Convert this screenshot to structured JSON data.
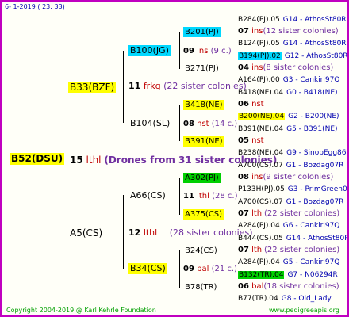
{
  "header": {
    "date": "6-  1-2019 (  23:  33)"
  },
  "footer": {
    "copyright": "Copyright 2004-2019 @ Karl Kehrle Foundation",
    "url": "www.pedigreeapis.org"
  },
  "root": {
    "name": "B52(DSU)",
    "num": "15",
    "code": "lthl",
    "note": "(Drones from 31 sister colonies)"
  },
  "gen1": [
    {
      "name": "B33(BZF)",
      "num": "11",
      "code": "frkg",
      "note": "(22 sister colonies)"
    },
    {
      "name": "A5(CS)",
      "num": "12",
      "code": "lthl",
      "note": "(28 sister colonies)"
    }
  ],
  "gen2": [
    {
      "name": "B100(JG)",
      "num": "09",
      "code": "ins",
      "note": "(9 c.)"
    },
    {
      "name": "B104(SL)",
      "num": "08",
      "code": "nst",
      "note": "(14 c.)"
    },
    {
      "name": "A66(CS)",
      "num": "11",
      "code": "lthl",
      "note": "(28 c.)"
    },
    {
      "name": "B34(CS)",
      "num": "09",
      "code": "bal",
      "note": "(21 c.)"
    }
  ],
  "gen3": [
    {
      "name": "B201(PJ)",
      "num": "07",
      "code": "ins",
      "note": "(12 sister colonies)"
    },
    {
      "name": "B271(PJ)",
      "num": "04",
      "code": "ins",
      "note": "(8 sister colonies)"
    },
    {
      "name": "B418(NE)",
      "num": "06",
      "code": "nst",
      "note": ""
    },
    {
      "name": "B391(NE)",
      "num": "05",
      "code": "nst",
      "note": ""
    },
    {
      "name": "A302(PJ)",
      "num": "08",
      "code": "ins",
      "note": "(9 sister colonies)"
    },
    {
      "name": "A375(CS)",
      "num": "07",
      "code": "lthl",
      "note": "(22 sister colonies)"
    },
    {
      "name": "B24(CS)",
      "num": "07",
      "code": "lthl",
      "note": "(22 sister colonies)"
    },
    {
      "name": "B78(TR)",
      "num": "06",
      "code": "bal",
      "note": "(18 sister colonies)"
    }
  ],
  "gen4": [
    {
      "name": "B284(PJ).05",
      "sire": "G14 - AthosSt80R"
    },
    {
      "name": "B124(PJ).05",
      "sire": "G14 - AthosSt80R"
    },
    {
      "name": "B194(PJ).02",
      "sire": "G12 - AthosSt80R"
    },
    {
      "name": "A164(PJ).00",
      "sire": "G3 - Cankiri97Q"
    },
    {
      "name": "B418(NE).04",
      "sire": "G0 - B418(NE)"
    },
    {
      "name": "B200(NE).04",
      "sire": "G2 - B200(NE)"
    },
    {
      "name": "B391(NE).04",
      "sire": "G5 - B391(NE)"
    },
    {
      "name": "B238(NE).04",
      "sire": "G9 - SinopEgg86R"
    },
    {
      "name": "A700(CS).07",
      "sire": "G1 - Bozdag07R"
    },
    {
      "name": "P133H(PJ).05",
      "sire": "G3 - PrimGreen00"
    },
    {
      "name": "A700(CS).07",
      "sire": "G1 - Bozdag07R"
    },
    {
      "name": "A284(PJ).04",
      "sire": "G6 - Cankiri97Q"
    },
    {
      "name": "B444(CS).05",
      "sire": "G14 - AthosSt80R"
    },
    {
      "name": "A284(PJ).04",
      "sire": "G5 - Cankiri97Q"
    },
    {
      "name": "B132(TR).04",
      "sire": "G7 - N06294R"
    },
    {
      "name": "B77(TR).04",
      "sire": "G8 - Old_Lady"
    }
  ]
}
